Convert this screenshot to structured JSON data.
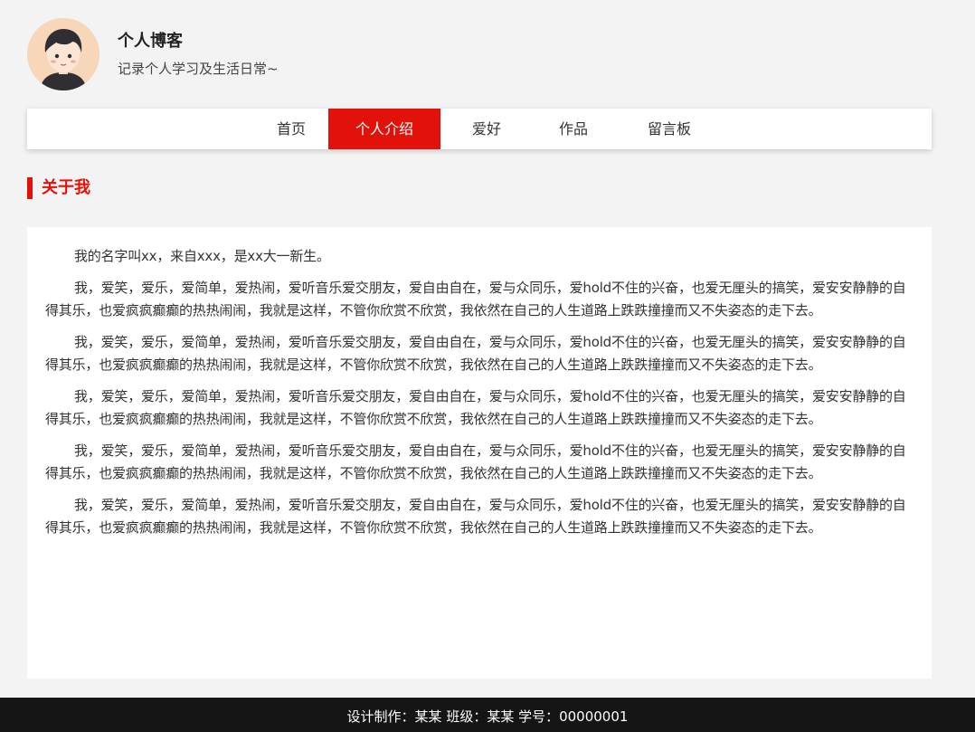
{
  "header": {
    "title": "个人博客",
    "subtitle": "记录个人学习及生活日常~",
    "avatar_icon": "cartoon-boy-avatar"
  },
  "nav": {
    "items": [
      {
        "label": "首页",
        "active": false
      },
      {
        "label": "个人介绍",
        "active": true
      },
      {
        "label": "爱好",
        "active": false
      },
      {
        "label": "作品",
        "active": false
      },
      {
        "label": "留言板",
        "active": false
      }
    ]
  },
  "section": {
    "title": "关于我"
  },
  "content": {
    "paragraphs": [
      "我的名字叫xx，来自xxx，是xx大一新生。",
      "我，爱笑，爱乐，爱简单，爱热闹，爱听音乐爱交朋友，爱自由自在，爱与众同乐，爱hold不住的兴奋，也爱无厘头的搞笑，爱安安静静的自得其乐，也爱疯疯癫癫的热热闹闹，我就是这样，不管你欣赏不欣赏，我依然在自己的人生道路上跌跌撞撞而又不失姿态的走下去。",
      "我，爱笑，爱乐，爱简单，爱热闹，爱听音乐爱交朋友，爱自由自在，爱与众同乐，爱hold不住的兴奋，也爱无厘头的搞笑，爱安安静静的自得其乐，也爱疯疯癫癫的热热闹闹，我就是这样，不管你欣赏不欣赏，我依然在自己的人生道路上跌跌撞撞而又不失姿态的走下去。",
      "我，爱笑，爱乐，爱简单，爱热闹，爱听音乐爱交朋友，爱自由自在，爱与众同乐，爱hold不住的兴奋，也爱无厘头的搞笑，爱安安静静的自得其乐，也爱疯疯癫癫的热热闹闹，我就是这样，不管你欣赏不欣赏，我依然在自己的人生道路上跌跌撞撞而又不失姿态的走下去。",
      "我，爱笑，爱乐，爱简单，爱热闹，爱听音乐爱交朋友，爱自由自在，爱与众同乐，爱hold不住的兴奋，也爱无厘头的搞笑，爱安安静静的自得其乐，也爱疯疯癫癫的热热闹闹，我就是这样，不管你欣赏不欣赏，我依然在自己的人生道路上跌跌撞撞而又不失姿态的走下去。",
      "我，爱笑，爱乐，爱简单，爱热闹，爱听音乐爱交朋友，爱自由自在，爱与众同乐，爱hold不住的兴奋，也爱无厘头的搞笑，爱安安静静的自得其乐，也爱疯疯癫癫的热热闹闹，我就是这样，不管你欣赏不欣赏，我依然在自己的人生道路上跌跌撞撞而又不失姿态的走下去。"
    ]
  },
  "footer": {
    "text": "设计制作：某某 班级：某某 学号：00000001"
  },
  "colors": {
    "accent": "#e2120b",
    "page_background": "#f3f3f3",
    "footer_background": "#151515"
  }
}
